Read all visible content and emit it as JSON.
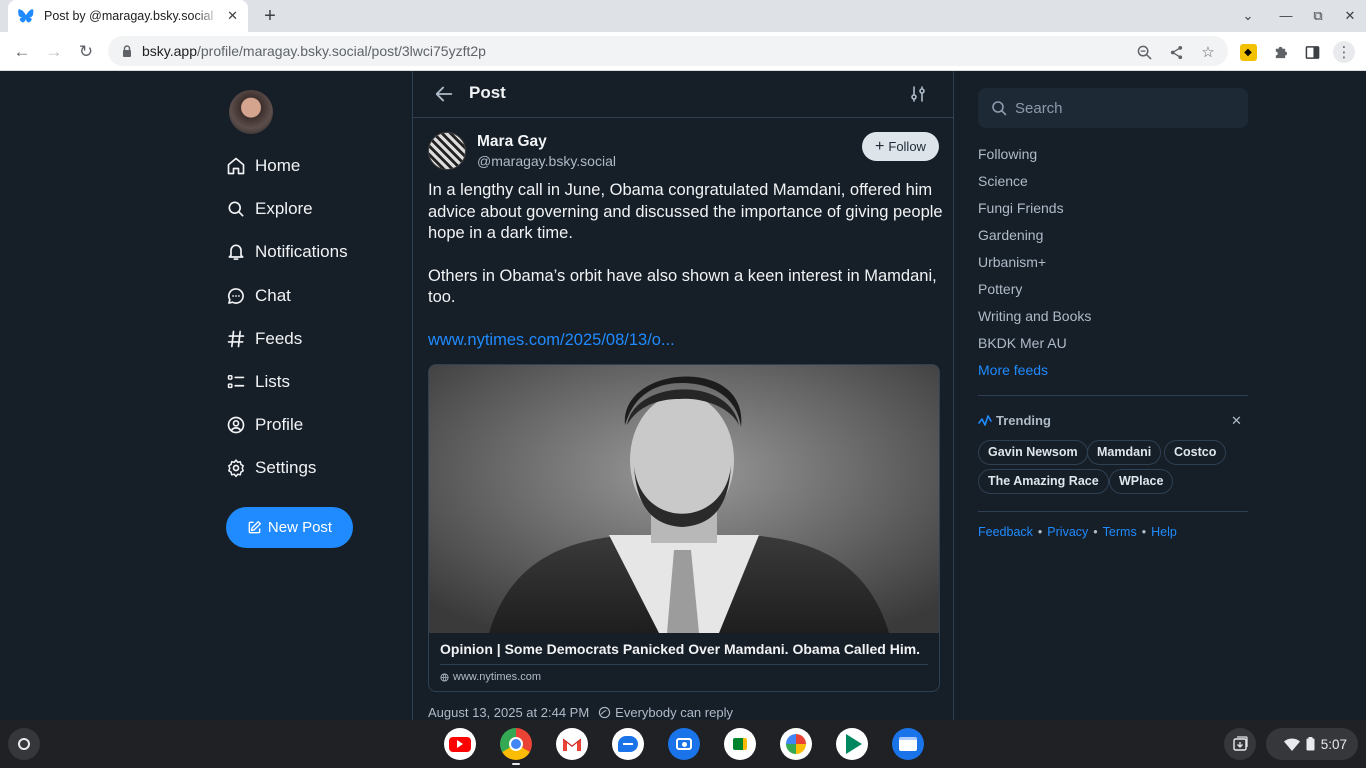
{
  "browser": {
    "tab_title": "Post by @maragay.bsky.social",
    "url_domain": "bsky.app",
    "url_path": "/profile/maragay.bsky.social/post/3lwci75yzft2p"
  },
  "nav": {
    "items": [
      {
        "label": "Home",
        "icon": "home-icon"
      },
      {
        "label": "Explore",
        "icon": "search-icon"
      },
      {
        "label": "Notifications",
        "icon": "bell-icon"
      },
      {
        "label": "Chat",
        "icon": "chat-icon"
      },
      {
        "label": "Feeds",
        "icon": "hash-icon"
      },
      {
        "label": "Lists",
        "icon": "list-icon"
      },
      {
        "label": "Profile",
        "icon": "user-circle-icon"
      },
      {
        "label": "Settings",
        "icon": "gear-icon"
      }
    ],
    "new_post": "New Post"
  },
  "header": {
    "title": "Post"
  },
  "post": {
    "author_name": "Mara Gay",
    "author_handle": "@maragay.bsky.social",
    "follow_label": "Follow",
    "paragraph1": "In a lengthy call in June, Obama congratulated Mamdani, offered him advice about governing and discussed the importance of giving people hope in a dark time.",
    "paragraph2": "Others in Obama’s orbit have also shown a keen interest in Mamdani, too.",
    "link": "www.nytimes.com/2025/08/13/o...",
    "card_title": "Opinion | Some Democrats Panicked Over Mamdani. Obama Called Him.",
    "card_domain": "www.nytimes.com",
    "timestamp": "August 13, 2025 at 2:44 PM",
    "reply_setting": "Everybody can reply"
  },
  "sidebar": {
    "search_placeholder": "Search",
    "feeds": [
      "Following",
      "Science",
      "Fungi Friends",
      "Gardening",
      "Urbanism+",
      "Pottery",
      "Writing and Books",
      "BKDK Mer AU"
    ],
    "more_feeds": "More feeds",
    "trending_title": "Trending",
    "trending": [
      "Gavin Newsom",
      "Mamdani",
      "Costco",
      "The Amazing Race",
      "WPlace"
    ],
    "footer": [
      "Feedback",
      "Privacy",
      "Terms",
      "Help"
    ]
  },
  "shelf": {
    "apps": [
      "YouTube",
      "Chrome",
      "Gmail",
      "Messages",
      "Camera",
      "Meet",
      "Photos",
      "Play Store",
      "Files"
    ],
    "time": "5:07"
  },
  "colors": {
    "accent": "#208bfe",
    "background": "#161e27",
    "border": "#2e4052"
  }
}
